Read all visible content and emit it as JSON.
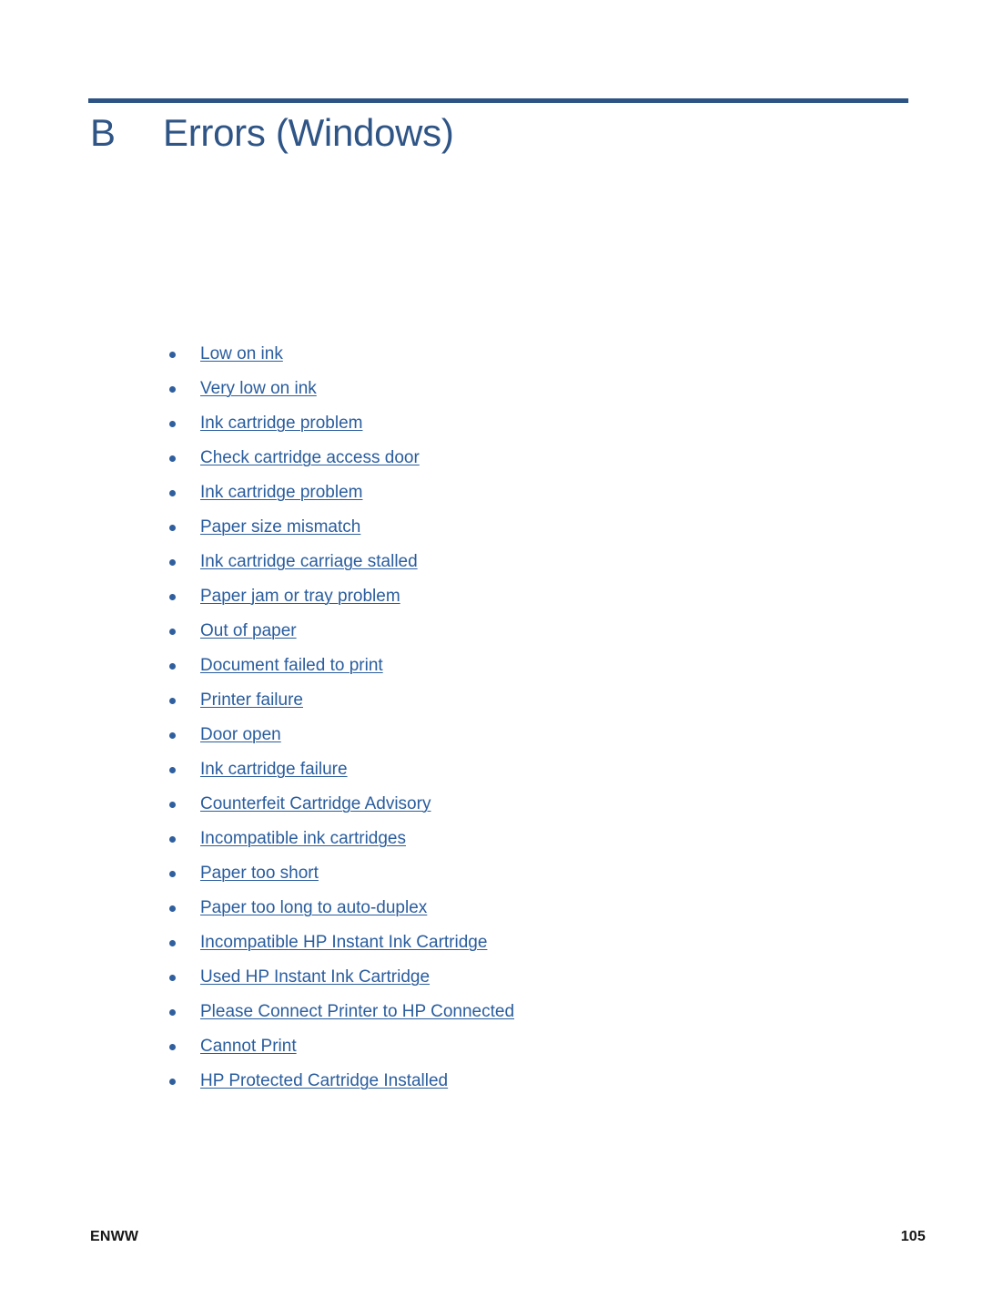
{
  "document": {
    "chapter_letter": "B",
    "chapter_title": "Errors (Windows)",
    "rule_color": "#2c5384",
    "heading_color": "#2f5586",
    "link_color": "#2a5d9e"
  },
  "toc": {
    "items": [
      {
        "label": "Low on ink"
      },
      {
        "label": "Very low on ink"
      },
      {
        "label": "Ink cartridge problem"
      },
      {
        "label": "Check cartridge access door"
      },
      {
        "label": "Ink cartridge problem"
      },
      {
        "label": "Paper size mismatch"
      },
      {
        "label": "Ink cartridge carriage stalled"
      },
      {
        "label": "Paper jam or tray problem"
      },
      {
        "label": "Out of paper"
      },
      {
        "label": "Document failed to print"
      },
      {
        "label": "Printer failure"
      },
      {
        "label": "Door open"
      },
      {
        "label": "Ink cartridge failure"
      },
      {
        "label": "Counterfeit Cartridge Advisory"
      },
      {
        "label": "Incompatible ink cartridges"
      },
      {
        "label": "Paper too short"
      },
      {
        "label": "Paper too long to auto-duplex"
      },
      {
        "label": "Incompatible HP Instant Ink Cartridge"
      },
      {
        "label": "Used HP Instant Ink Cartridge"
      },
      {
        "label": "Please Connect Printer to HP Connected"
      },
      {
        "label": "Cannot Print"
      },
      {
        "label": "HP Protected Cartridge Installed"
      }
    ]
  },
  "footer": {
    "locale": "ENWW",
    "page_number": "105"
  }
}
